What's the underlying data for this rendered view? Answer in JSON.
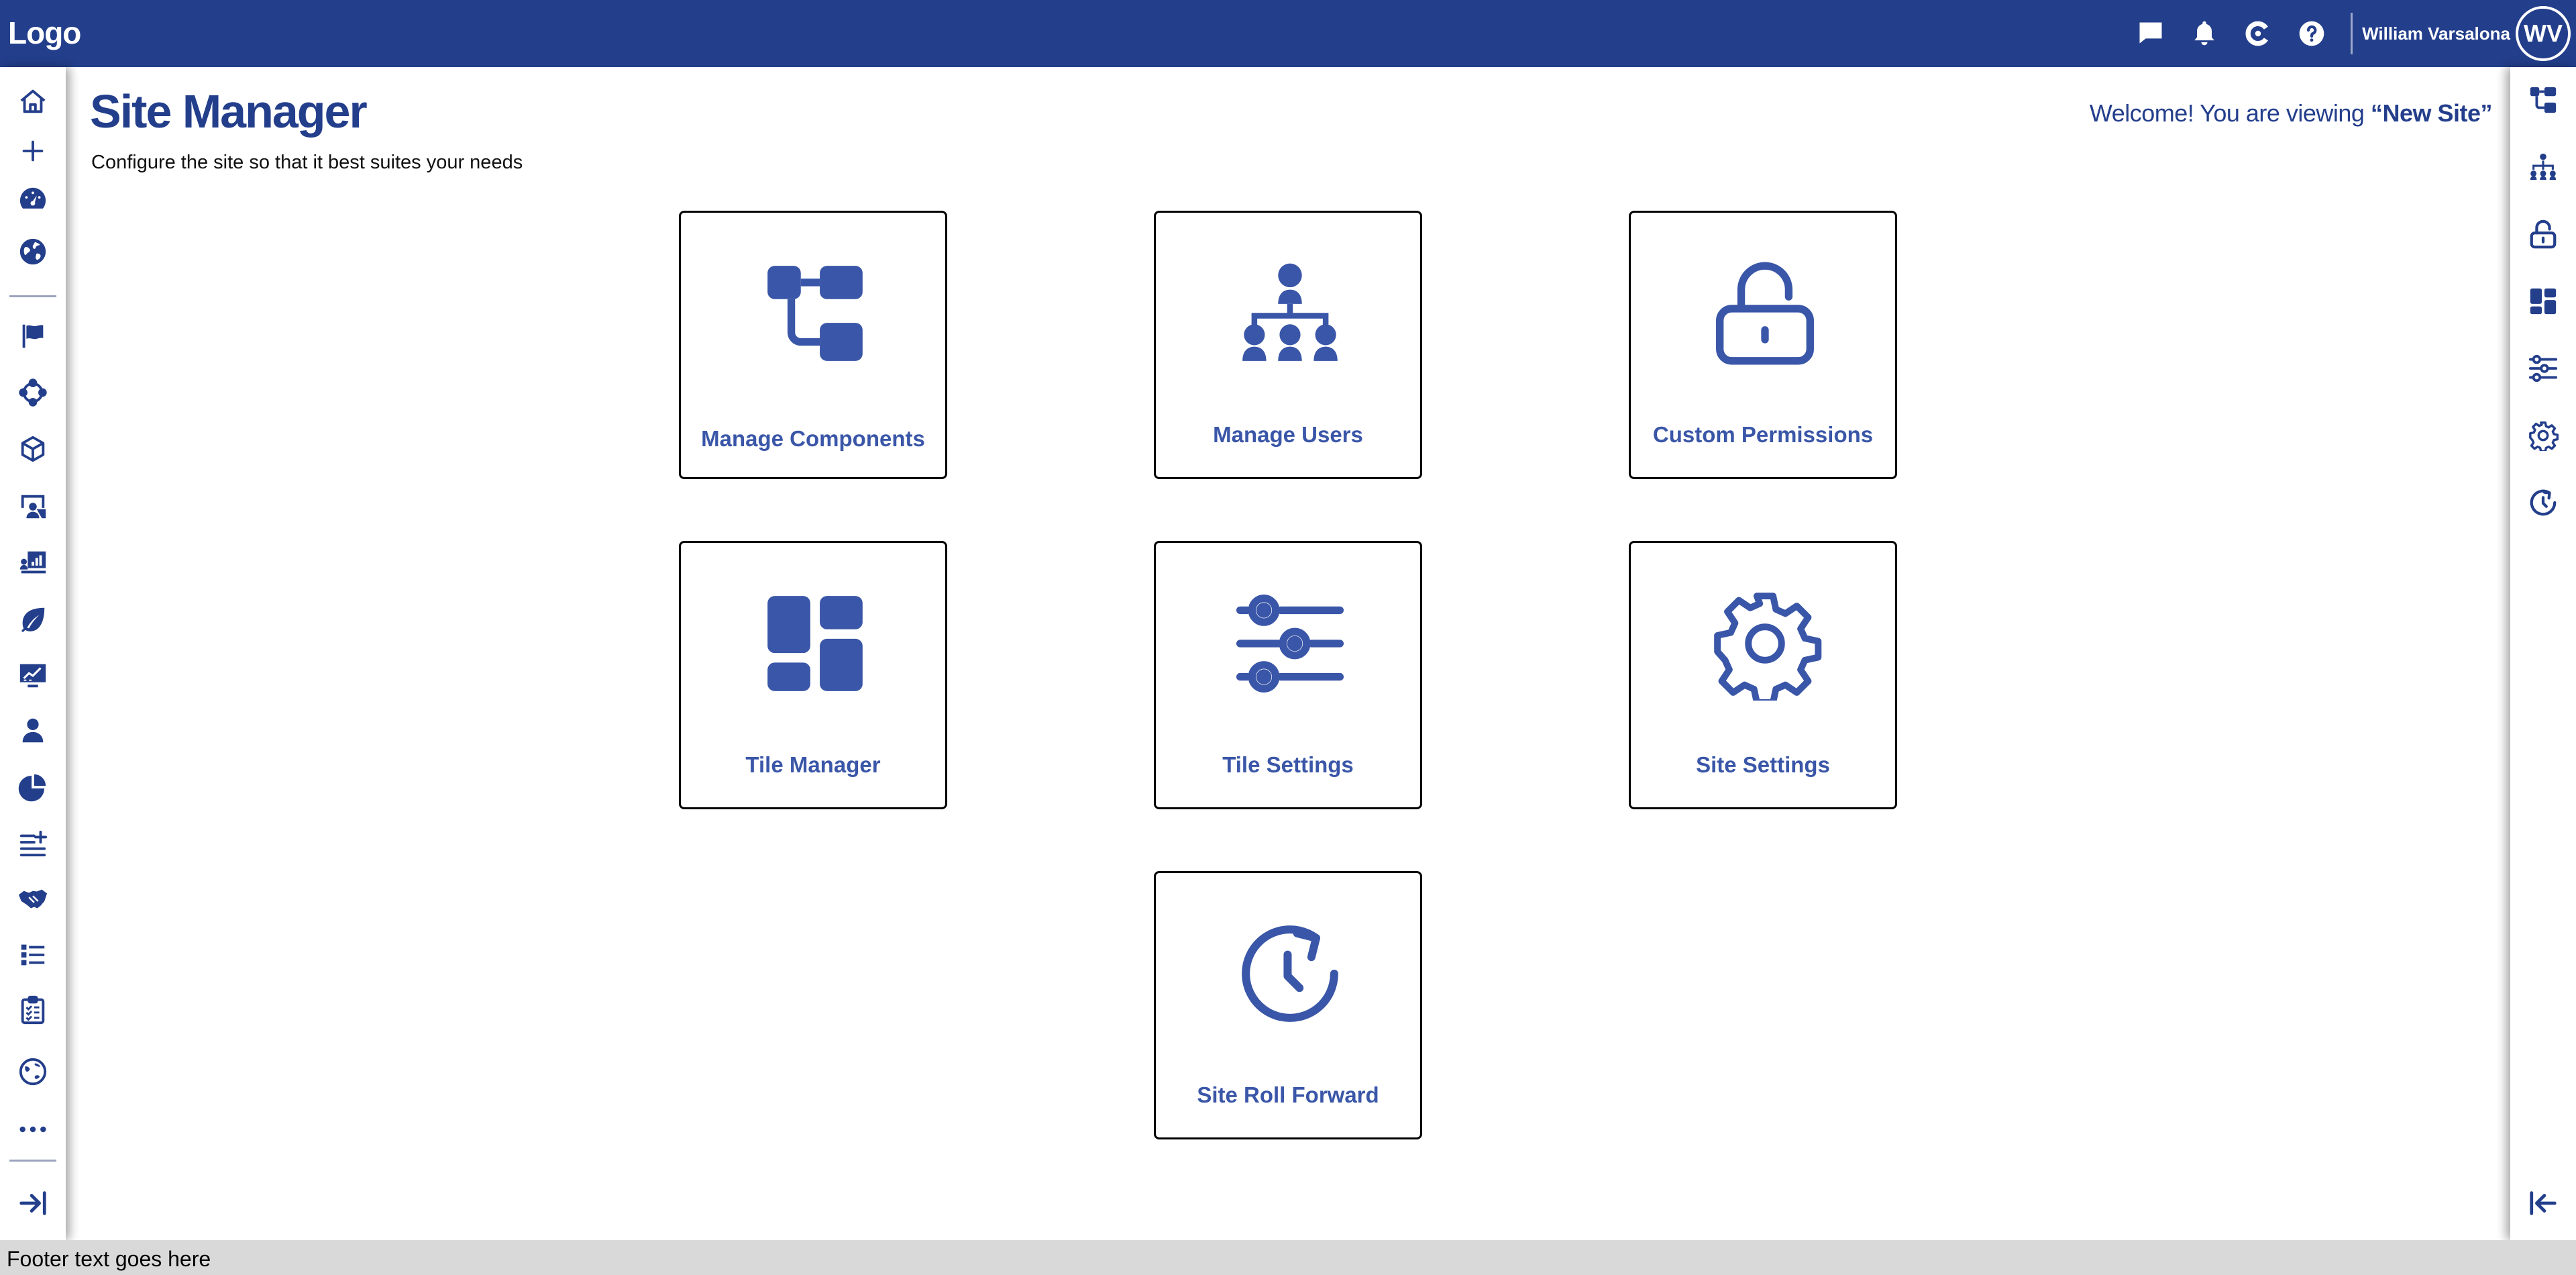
{
  "header": {
    "logo": "Logo",
    "icons": [
      "chat-icon",
      "bell-icon",
      "c-brand-icon",
      "help-icon"
    ],
    "user_name": "William Varsalona",
    "user_initials": "WV"
  },
  "left_nav": {
    "icons": [
      "home-icon",
      "plus-icon",
      "dashboard-gauge-icon",
      "globe-icon",
      "flag-icon",
      "network-cycle-icon",
      "cube-icon",
      "presenter-icon",
      "analytics-board-icon",
      "leaf-icon",
      "monitor-chart-icon",
      "person-icon",
      "pie-chart-icon",
      "list-add-icon",
      "handshake-icon",
      "list-icon",
      "clipboard-icon",
      "world-sync-icon",
      "more-icon",
      "expand-arrow-icon"
    ]
  },
  "right_nav": {
    "icons": [
      "components-icon",
      "org-chart-icon",
      "unlock-icon",
      "tiles-icon",
      "sliders-icon",
      "gear-icon",
      "history-icon",
      "collapse-arrow-icon"
    ]
  },
  "page": {
    "title": "Site Manager",
    "subtitle": "Configure the site so that it best suites your needs",
    "welcome_prefix": "Welcome! You are viewing ",
    "site_name": "“New Site”"
  },
  "tiles": [
    {
      "label": "Manage Components",
      "icon": "components-icon"
    },
    {
      "label": "Manage Users",
      "icon": "org-chart-icon"
    },
    {
      "label": "Custom Permissions",
      "icon": "unlock-icon"
    },
    {
      "label": "Tile Manager",
      "icon": "tiles-icon"
    },
    {
      "label": "Tile Settings",
      "icon": "sliders-icon"
    },
    {
      "label": "Site Settings",
      "icon": "gear-icon"
    },
    {
      "label": "Site Roll Forward",
      "icon": "history-icon"
    }
  ],
  "footer": {
    "text": "Footer text goes here"
  },
  "colors": {
    "brand": "#233e8b",
    "icon_blue": "#3a56a8",
    "footer_bg": "#d9d9d9"
  }
}
